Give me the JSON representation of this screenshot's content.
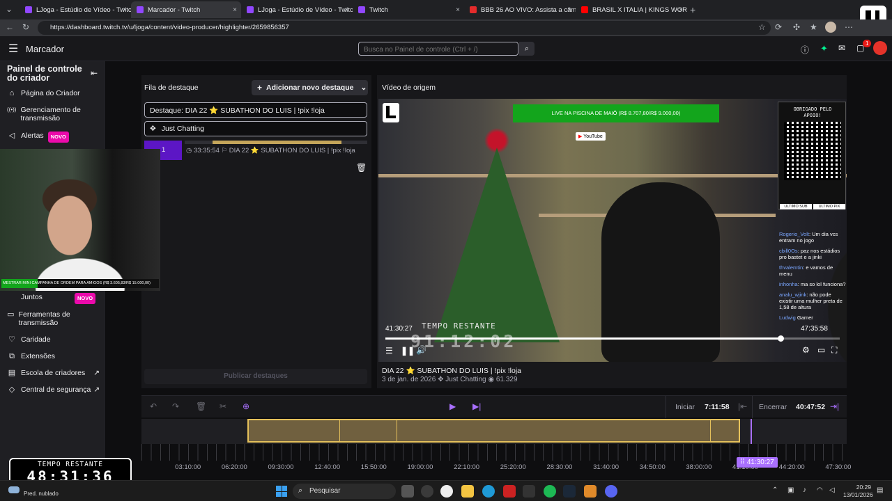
{
  "browser": {
    "tabs": [
      {
        "label": "LJoga - Estúdio de Vídeo - Twitch",
        "color": "#9147ff"
      },
      {
        "label": "Marcador - Twitch",
        "color": "#9147ff"
      },
      {
        "label": "LJoga - Estúdio de Vídeo - Twitch",
        "color": "#9147ff"
      },
      {
        "label": "Twitch",
        "color": "#9147ff"
      },
      {
        "label": "BBB 26 AO VIVO: Assista a câmera",
        "color": "#e52b2b"
      },
      {
        "label": "BRASIL X ITALIA | KINGS WORLD C",
        "color": "#ff0000"
      }
    ],
    "new_tab": "+",
    "close": "×",
    "url": "https://dashboard.twitch.tv/u/ljoga/content/video-producer/highlighter/2659856357"
  },
  "header": {
    "menu_icon": "☰",
    "title": "Marcador",
    "search_placeholder": "Busca no Painel de controle (Ctrl + /)",
    "notif_count": "1"
  },
  "sidebar": {
    "title": "Painel de controle do criador",
    "items": [
      {
        "label": "Página do Criador",
        "icon": "⌂"
      },
      {
        "label": "Gerenciamento de transmissão",
        "icon": "((•))"
      },
      {
        "label": "Alertas",
        "icon": "◁",
        "badge": "NOVO"
      },
      {
        "label": "Juntos",
        "icon": "",
        "badge": "NOVO"
      },
      {
        "label": "Ferramentas de transmissão",
        "icon": "▭"
      },
      {
        "label": "Caridade",
        "icon": "♡"
      },
      {
        "label": "Extensões",
        "icon": "⧉"
      },
      {
        "label": "Escola de criadores",
        "icon": "▤",
        "ext": "↗"
      },
      {
        "label": "Central de segurança",
        "icon": "◇",
        "ext": "↗"
      }
    ]
  },
  "queue": {
    "title": "Fila de destaque",
    "add_button": "Adicionar novo destaque",
    "title_field": "Destaque: DIA 22 ⭐ SUBATHON DO LUIS | !pix !loja",
    "category_field": "Just Chatting",
    "item_number": "1",
    "item_duration": "33:35:54",
    "item_title": "DIA 22 ⭐ SUBATHON DO LUIS | !pix !loja",
    "publish_button": "Publicar destaques"
  },
  "source": {
    "title": "Vídeo de origem",
    "video_title": "DIA 22 ⭐ SUBATHON DO LUIS | !pix !loja",
    "date": "3 de jan. de 2026",
    "category": "Just Chatting",
    "views": "61.329",
    "current_time": "41:30:27",
    "end_time": "47:35:58",
    "progress_fraction": 0.87
  },
  "overlay": {
    "banner": "LIVE NA PISCINA DE MAIÔ (R$ 8.707,80/R$ 9.000,00)",
    "youtube_label": "YouTube",
    "thanks": "OBRIGADO PELO APOIO!",
    "last_sub": "ULTIMO SUB",
    "last_pix": "ULTIMO PIX",
    "timer_label": "TEMPO RESTANTE",
    "timer_value": "91:12:02",
    "chat": [
      {
        "name": "Rogerio_Volt",
        "text": "Um dia vcs entram no jogo"
      },
      {
        "name": "cbill0Os",
        "text": "paz nos estádios pro bastet e a jinki"
      },
      {
        "name": "thvalemtin",
        "text": "e vamos de menu"
      },
      {
        "name": "inhonha",
        "text": "ma so lol funciona?"
      },
      {
        "name": "analu_wjink",
        "text": "não pode existir uma mulher preta de 1,58 de altura"
      },
      {
        "name": "Ludwig",
        "text": "Gamer"
      }
    ]
  },
  "cam_overlay": {
    "campaign": "MESTRAR MINI CAMPANHA DE ORDEM PARA AMIGOS (R$ 3.605,83/R$ 15.000,00)"
  },
  "timeline": {
    "start_label": "Iniciar",
    "start_time": "7:11:58",
    "end_label": "Encerrar",
    "end_time": "40:47:52",
    "playhead": "41:30:27",
    "ticks": [
      "03:10:00",
      "06:20:00",
      "09:30:00",
      "12:40:00",
      "15:50:00",
      "19:00:00",
      "22:10:00",
      "25:20:00",
      "28:30:00",
      "31:40:00",
      "34:50:00",
      "38:00:00",
      "41:10:00",
      "44:20:00",
      "47:30:00"
    ],
    "total_hours": 47.6,
    "clip_start_hours": 7.199,
    "clip_end_hours": 40.798
  },
  "countdown": {
    "label": "TEMPO RESTANTE",
    "value": "48:31:36"
  },
  "taskbar": {
    "search": "Pesquisar",
    "weather": "Pred. nublado",
    "time": "20:29",
    "date": "13/01/2026"
  }
}
